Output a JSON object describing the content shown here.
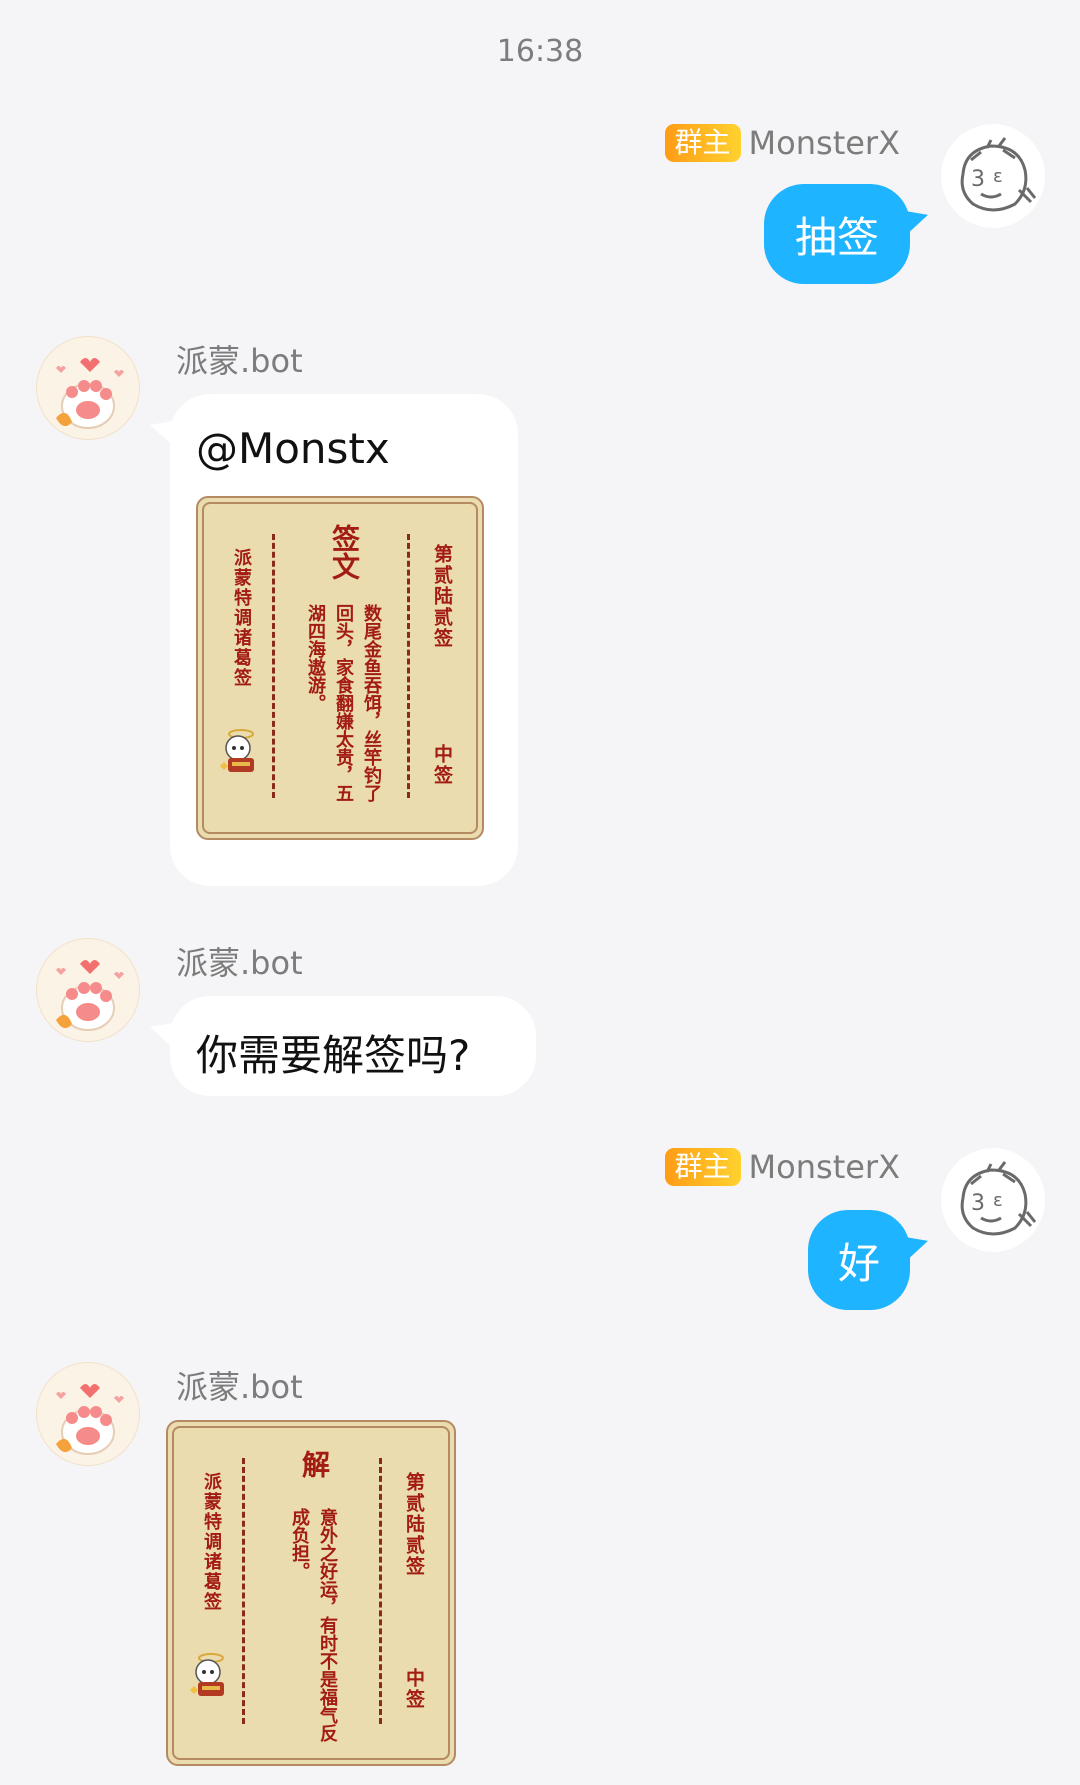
{
  "time": "16:38",
  "owner_badge": "群主",
  "user_name": "MonsterX",
  "bot_name": "派蒙.bot",
  "messages": {
    "m1_text": "抽签",
    "m2_mention": "@Monstx",
    "m3_text": "你需要解签吗?",
    "m4_text": "好"
  },
  "card1": {
    "right_col1": "第贰陆贰签",
    "right_col2": "中签",
    "heading": "签文",
    "text_col1": "数尾金鱼吞饵，丝竿钓了",
    "text_col2": "回头，家食翻嫌太贵，五",
    "text_col3": "湖四海遨游。",
    "left_col": "派蒙特调诸葛签"
  },
  "card2": {
    "right_col1": "第贰陆贰签",
    "right_col2": "中签",
    "heading": "解",
    "text_col1": "意外之好运，有时不是福气反",
    "text_col2": "成负担。",
    "left_col": "派蒙特调诸葛签"
  },
  "colors": {
    "me_bubble": "#1eb4ff",
    "bot_bubble": "#ffffff",
    "badge": "#ffa81c",
    "card_bg": "#eadcae",
    "card_text": "#a31c14"
  },
  "icons": {
    "user_avatar": "sketch-face-avatar",
    "bot_avatar": "cat-paw-avatar",
    "card_mascot": "paimon-mascot-icon"
  }
}
